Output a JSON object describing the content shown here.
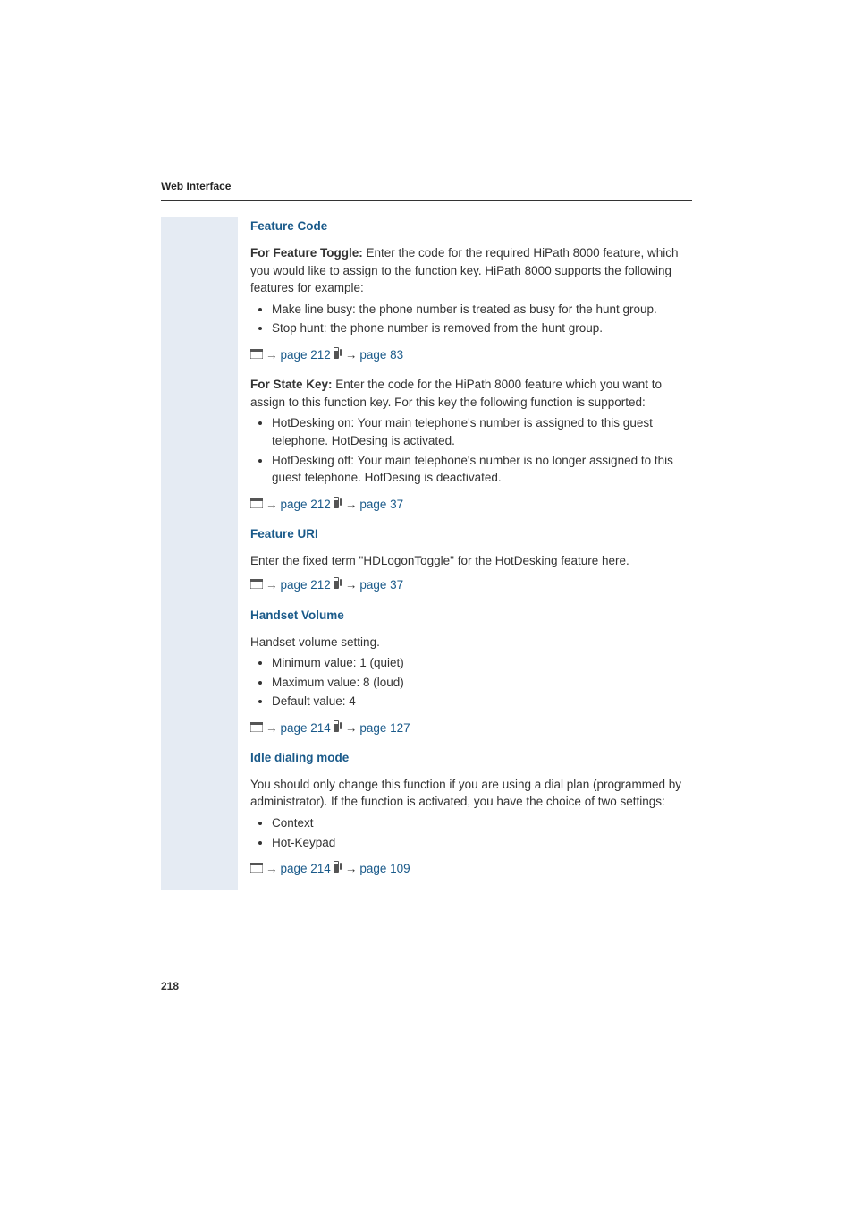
{
  "header_title": "Web Interface",
  "page_number": "218",
  "sections": {
    "feature_code": {
      "title": "Feature Code",
      "toggle_intro_bold": "For Feature Toggle: ",
      "toggle_intro_rest": "Enter the code for the required HiPath 8000 feature, which you would like to assign to the function key. HiPath 8000 supports the following features for example:",
      "toggle_bullets": [
        "Make line busy: the phone number is treated as busy for the hunt group.",
        "Stop hunt: the phone number is removed from the hunt group."
      ],
      "toggle_ref_a": "page 212",
      "toggle_ref_b": "page 83",
      "state_intro_bold": "For State Key: ",
      "state_intro_rest": "Enter the code for the HiPath 8000 feature which you want to assign to this function key. For this key the following function is supported:",
      "state_bullets": [
        "HotDesking on: Your main telephone's number is assigned to this guest telephone. HotDesing is activated.",
        "HotDesking off: Your main telephone's number is no longer assigned to this guest telephone. HotDesing is deactivated."
      ],
      "state_ref_a": "page 212",
      "state_ref_b": "page 37"
    },
    "feature_uri": {
      "title": "Feature URI",
      "text": "Enter the fixed term \"HDLogonToggle\" for the HotDesking feature here.",
      "ref_a": "page 212",
      "ref_b": "page 37"
    },
    "handset_volume": {
      "title": "Handset Volume",
      "text": "Handset volume setting.",
      "bullets": [
        "Minimum value: 1 (quiet)",
        "Maximum value: 8 (loud)",
        "Default value: 4"
      ],
      "ref_a": "page 214",
      "ref_b": "page 127"
    },
    "idle_dialing_mode": {
      "title": "Idle dialing mode",
      "text": "You should only change this function if you are using a dial plan (programmed by administrator). If the function is activated, you have the choice of two settings:",
      "bullets": [
        "Context",
        "Hot-Keypad"
      ],
      "ref_a": "page 214",
      "ref_b": "page 109"
    }
  }
}
